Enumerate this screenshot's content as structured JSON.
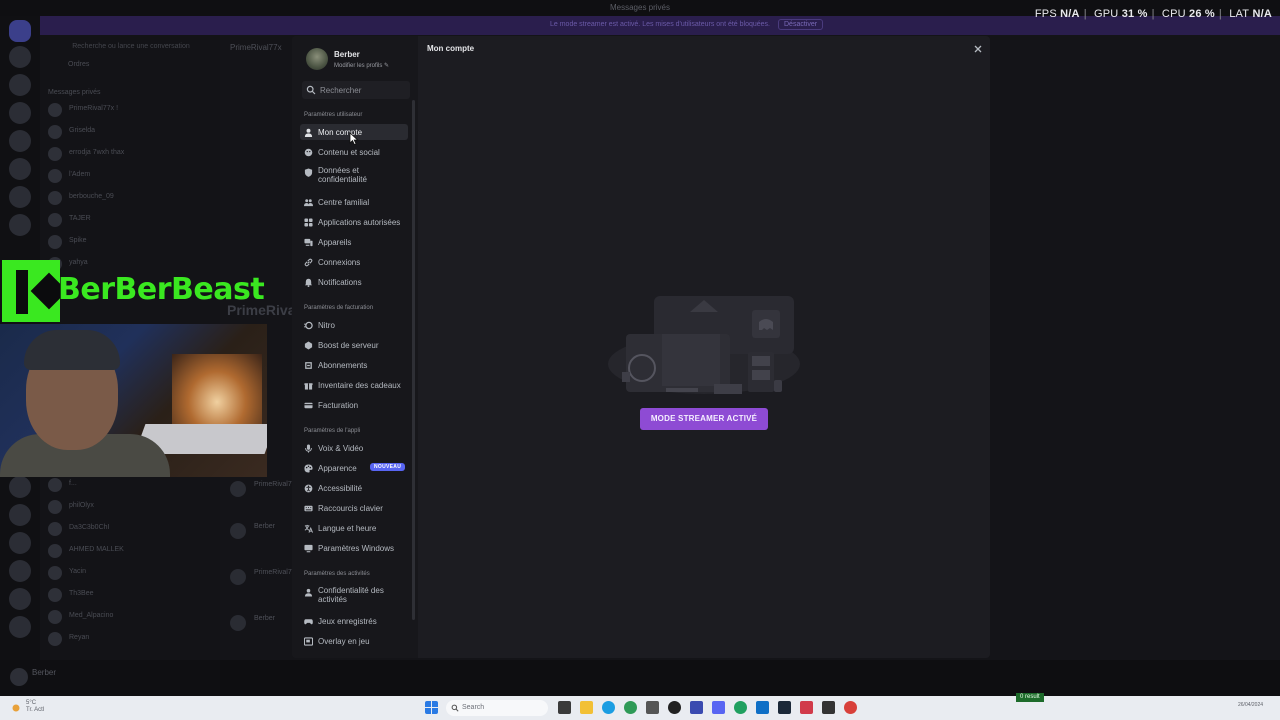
{
  "window": {
    "title": "Messages privés"
  },
  "notice": {
    "text": "Le mode streamer est activé. Les mises d'utilisateurs ont été bloquées.",
    "button": "Désactiver"
  },
  "overlay": {
    "fps_label": "FPS",
    "fps": "N/A",
    "gpu_label": "GPU",
    "gpu": "31 %",
    "cpu_label": "CPU",
    "cpu": "26 %",
    "lat_label": "LAT",
    "lat": "N/A"
  },
  "stream": {
    "brand": "BerBerBeast"
  },
  "dm": {
    "search_placeholder": "Recherche ou lance une conversation",
    "friends": "Ordres",
    "section": "Messages privés",
    "rows": [
      "PrimeRival77x !",
      "Griselda",
      "errodja 7wxh thax",
      "l'Adem",
      "berbouche_09",
      "TAJER",
      "Spike",
      "yahya"
    ],
    "rows_bottom": [
      "f...",
      "philOlyx",
      "Da3C3b0ChI",
      "AHMED MALLEK",
      "Yacin",
      "Th3Bee",
      "Med_Alpacino",
      "Reyan"
    ]
  },
  "chat": {
    "header": "PrimeRival77x",
    "ghost_name": "PrimeRiva",
    "messages": [
      "PrimeRival7",
      "Berber",
      "PrimeRival7",
      "Berber"
    ]
  },
  "userbar": {
    "name": "Berber"
  },
  "settings": {
    "profile": {
      "name": "Berber",
      "edit": "Modifier les profils"
    },
    "search_placeholder": "Rechercher",
    "content_title": "Mon compte",
    "streamer_button": "MODE STREAMER ACTIVÉ",
    "sections": {
      "user": "Paramètres utilisateur",
      "billing": "Paramètres de facturation",
      "app": "Paramètres de l'appli",
      "activity": "Paramètres des activités"
    },
    "user_items": [
      "Mon compte",
      "Contenu et social",
      "Données et confidentialité",
      "Centre familial",
      "Applications autorisées",
      "Appareils",
      "Connexions",
      "Notifications"
    ],
    "billing_items": [
      "Nitro",
      "Boost de serveur",
      "Abonnements",
      "Inventaire des cadeaux",
      "Facturation"
    ],
    "app_items": [
      "Voix & Vidéo",
      "Apparence",
      "Accessibilité",
      "Raccourcis clavier",
      "Langue et heure",
      "Paramètres Windows"
    ],
    "appearance_badge": "NOUVEAU",
    "activity_items": [
      "Confidentialité des activités",
      "Jeux enregistrés",
      "Overlay en jeu"
    ]
  },
  "taskbar": {
    "weather_temp": "5°C",
    "weather_desc": "Tr. Actl",
    "search_placeholder": "Search",
    "tray_status": "0 result",
    "time": "",
    "date": "26/04/2024"
  },
  "colors": {
    "accent": "#8e4bd4",
    "brand_green": "#3ae820",
    "blurple": "#5865f2"
  }
}
